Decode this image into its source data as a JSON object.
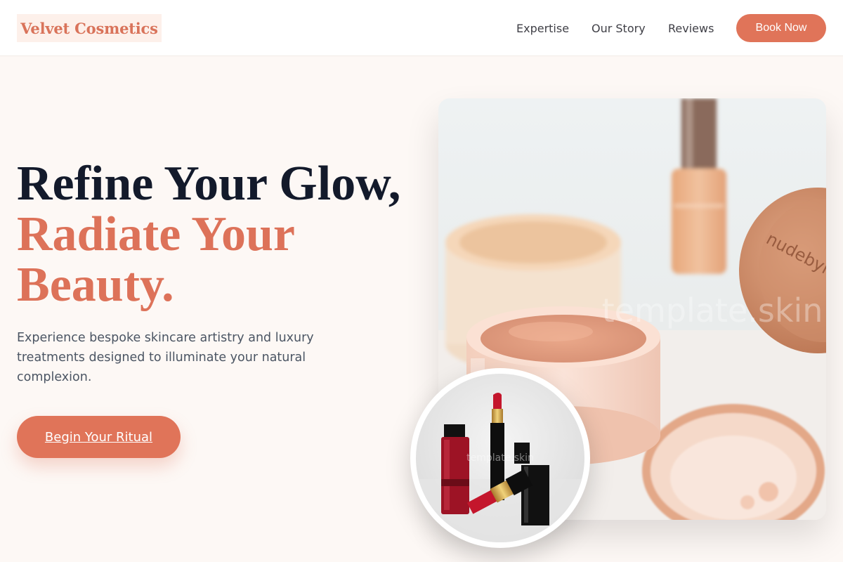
{
  "brand": {
    "name": "Velvet Cosmetics"
  },
  "nav": {
    "items": [
      {
        "label": "Expertise"
      },
      {
        "label": "Our Story"
      },
      {
        "label": "Reviews"
      }
    ],
    "cta_label": "Book Now"
  },
  "hero": {
    "headline_line1": "Refine Your Glow,",
    "headline_accent": "Radiate Your Beauty.",
    "description": "Experience bespoke skincare artistry and luxury treatments designed to illuminate your natural complexion.",
    "cta_label": "Begin Your Ritual"
  },
  "images": {
    "main_alt": "Loose powder jars and foundation bottle",
    "main_watermark": "template.skin",
    "jar_lid_text": "nudebyna",
    "circle_alt": "Red lipsticks and nail polish",
    "circle_watermark": "template.skin"
  },
  "colors": {
    "accent": "#e07459",
    "heading": "#131a2b",
    "body_text": "#4b5563",
    "page_bg": "#fdf8f5"
  }
}
